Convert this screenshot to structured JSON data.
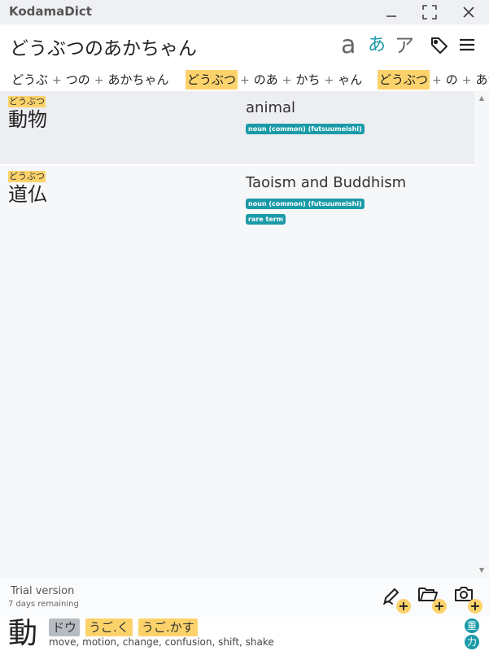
{
  "app": {
    "title": "KodamaDict"
  },
  "search": {
    "value": "どうぶつのあかちゃん"
  },
  "modes": {
    "romaji": "a",
    "hiragana": "あ",
    "katakana": "ア"
  },
  "colors": {
    "accent": "#1b9aa8",
    "highlight": "#fcd36b"
  },
  "icons": [
    "minimize-icon",
    "maximize-icon",
    "close-icon",
    "tag-icon",
    "menu-icon",
    "pen-icon",
    "folder-icon",
    "camera-icon",
    "plus-icon"
  ],
  "segmentations": [
    {
      "segments": [
        {
          "text": "どうぶ",
          "highlight": false
        },
        {
          "text": "つの",
          "highlight": false
        },
        {
          "text": "あかちゃん",
          "highlight": false
        }
      ]
    },
    {
      "segments": [
        {
          "text": "どうぶつ",
          "highlight": true
        },
        {
          "text": "のあ",
          "highlight": false
        },
        {
          "text": "かち",
          "highlight": false
        },
        {
          "text": "ゃん",
          "highlight": false
        }
      ]
    },
    {
      "segments": [
        {
          "text": "どうぶつ",
          "highlight": true
        },
        {
          "text": "の",
          "highlight": false
        },
        {
          "text": "あか",
          "highlight": false
        }
      ]
    }
  ],
  "results": [
    {
      "reading": "どうぶつ",
      "word": "動物",
      "gloss": "animal",
      "tags": [
        "noun (common) (futsuumeishi)"
      ]
    },
    {
      "reading": "どうぶつ",
      "word": "道仏",
      "gloss": "Taoism and Buddhism",
      "tags": [
        "noun (common) (futsuumeishi)",
        "rare term"
      ]
    }
  ],
  "footer": {
    "trial": "Trial version",
    "remaining": "7 days remaining"
  },
  "kanji": {
    "char": "動",
    "on_reading": "ドウ",
    "kun_readings": [
      "うご.く",
      "うご.かす"
    ],
    "meanings": "move, motion, change, confusion, shift, shake",
    "radicals": [
      "重",
      "力"
    ]
  }
}
